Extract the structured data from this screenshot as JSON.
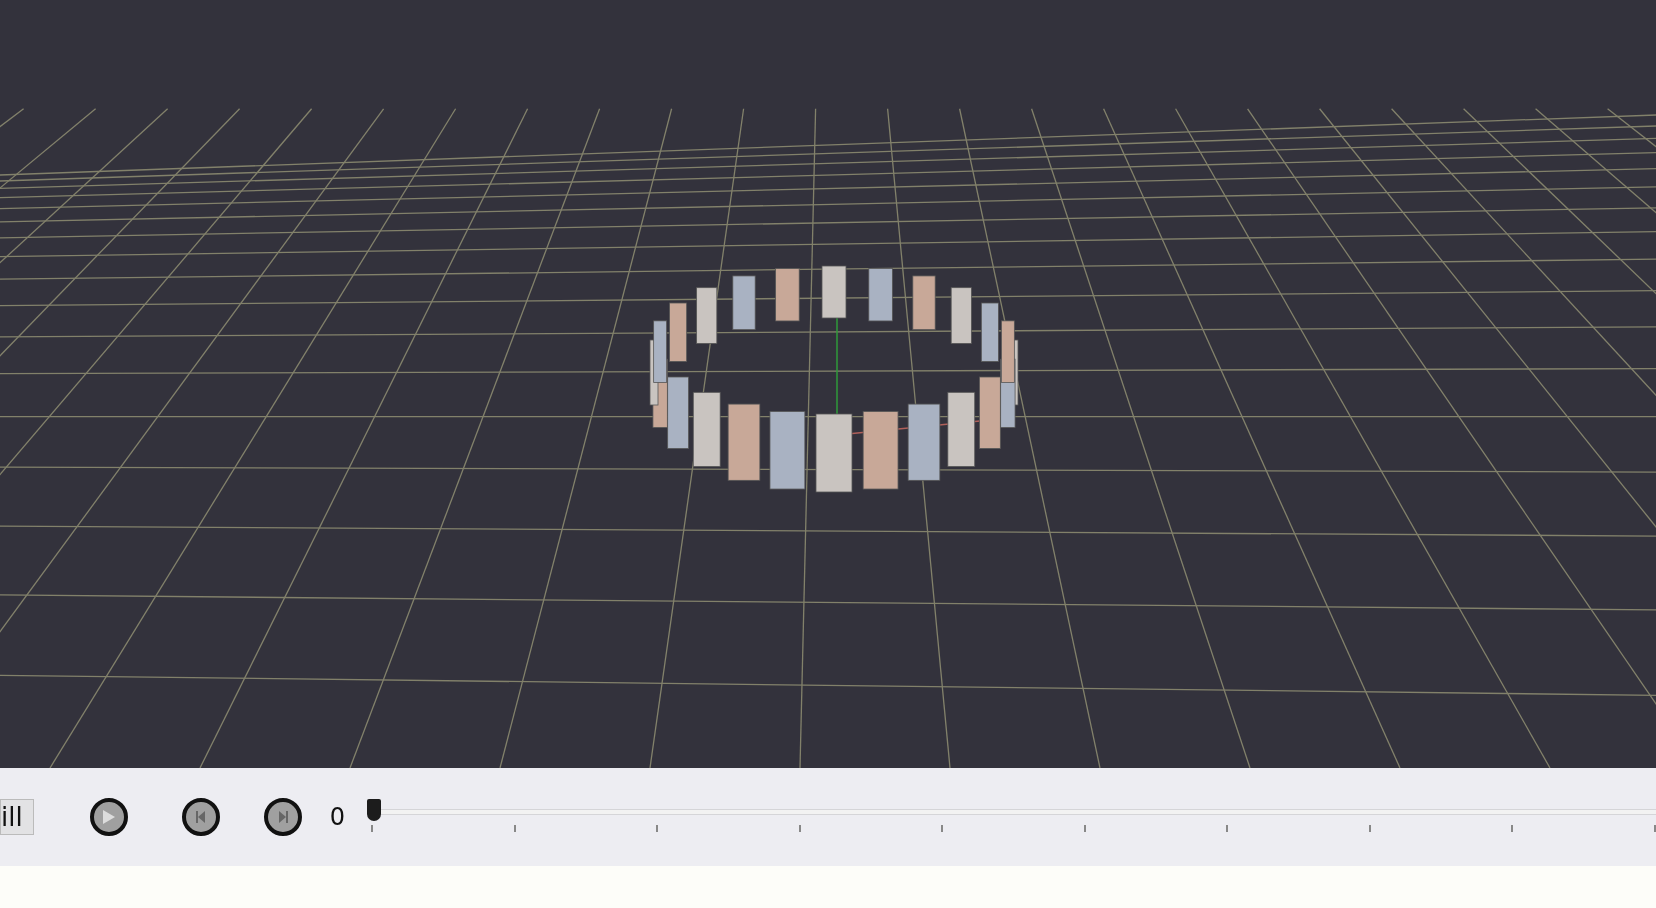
{
  "toolbar": {
    "kill_button": {
      "label": "ill"
    },
    "frame_counter": "0",
    "timeline_slider": {
      "level": 0
    }
  }
}
